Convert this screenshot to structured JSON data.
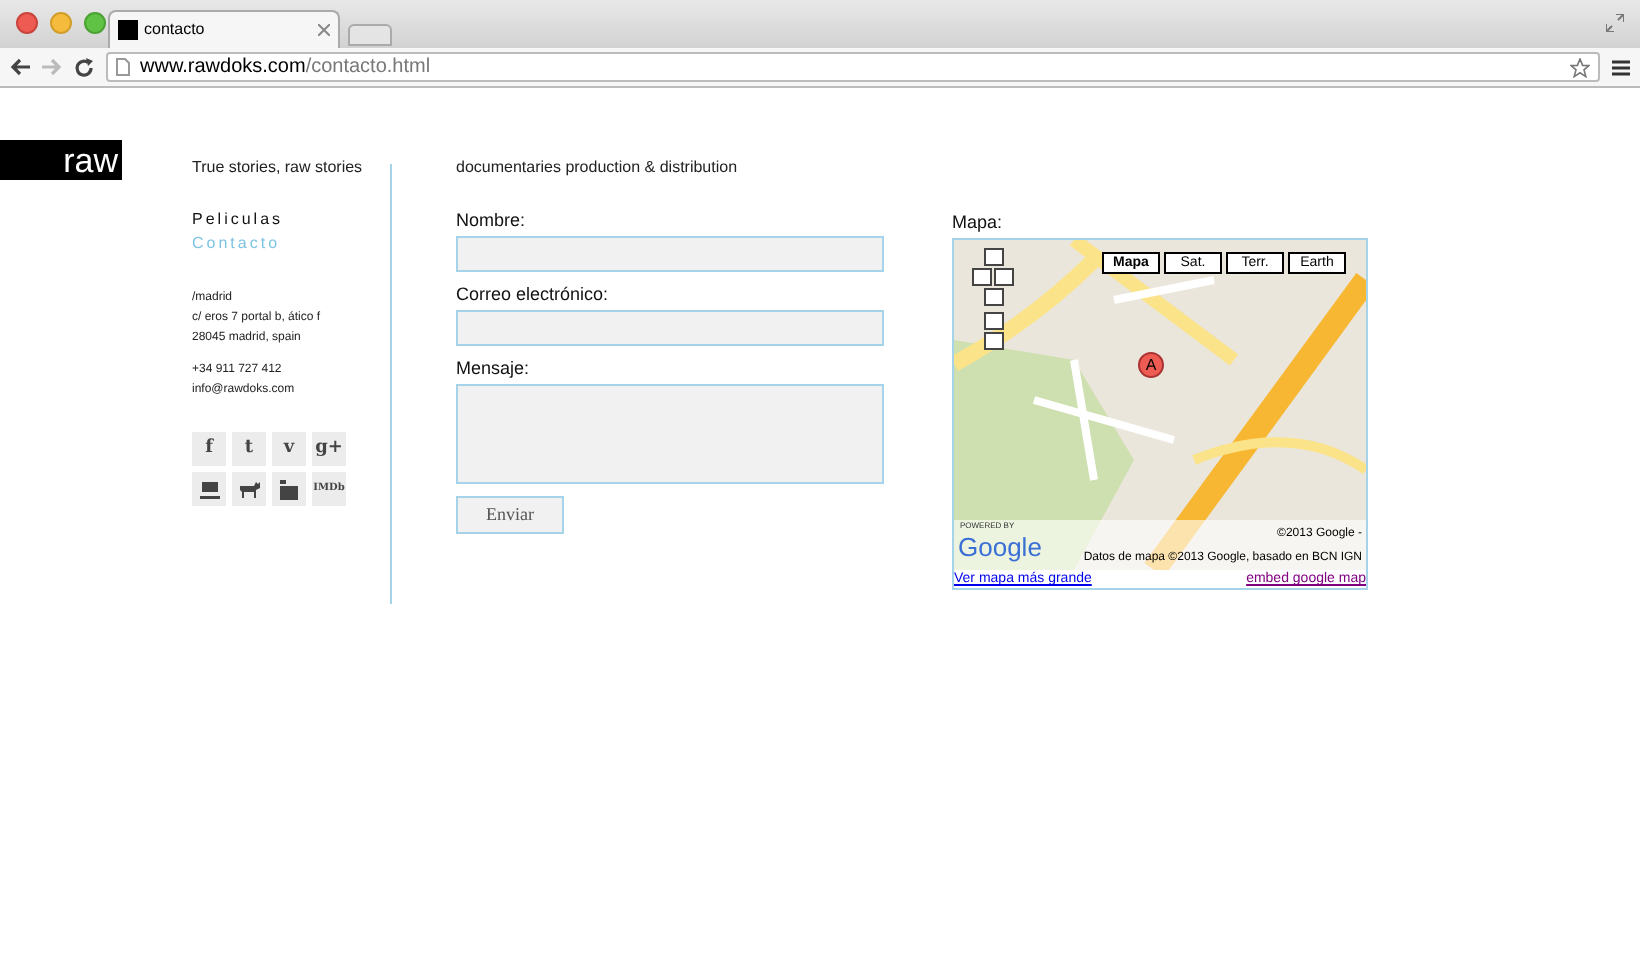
{
  "browser": {
    "tab_title": "contacto",
    "url_host": "www.rawdoks.com",
    "url_path": "/contacto.html"
  },
  "logo": "raw",
  "tagline": "True stories, raw stories",
  "nav": [
    {
      "label": "Peliculas",
      "selected": false
    },
    {
      "label": "Contacto",
      "selected": true
    }
  ],
  "address": [
    "/madrid",
    "c/ eros 7 portal b, ático f",
    "28045  madrid, spain"
  ],
  "contact": [
    "+34 911 727 412",
    "info@rawdoks.com"
  ],
  "social": [
    {
      "kind": "glyph",
      "label": "f"
    },
    {
      "kind": "glyph",
      "label": "t"
    },
    {
      "kind": "glyph",
      "label": "v"
    },
    {
      "kind": "glyph",
      "label": "g+"
    },
    {
      "kind": "monitor"
    },
    {
      "kind": "moose"
    },
    {
      "kind": "clapper"
    },
    {
      "kind": "glyph",
      "label": "IMDb"
    }
  ],
  "subtitle": "documentaries production & distribution",
  "form": {
    "fields": [
      {
        "label": "Nombre:",
        "kind": "input"
      },
      {
        "label": "Correo electrónico:",
        "kind": "input"
      },
      {
        "label": "Mensaje:",
        "kind": "textarea"
      }
    ],
    "submit": "Enviar"
  },
  "map": {
    "label": "Mapa:",
    "types": [
      {
        "label": "Mapa",
        "selected": true
      },
      {
        "label": "Sat.",
        "selected": false
      },
      {
        "label": "Terr.",
        "selected": false
      },
      {
        "label": "Earth",
        "selected": false
      }
    ],
    "marker": "A",
    "powered_by": "POWERED BY",
    "brand": "Google",
    "copyright": "©2013 Google -",
    "data_credit": "Datos de mapa ©2013 Google, basado en BCN IGN",
    "links": [
      {
        "label": "Ver mapa más grande",
        "visited": false
      },
      {
        "label": "embed google map",
        "visited": true
      }
    ]
  }
}
